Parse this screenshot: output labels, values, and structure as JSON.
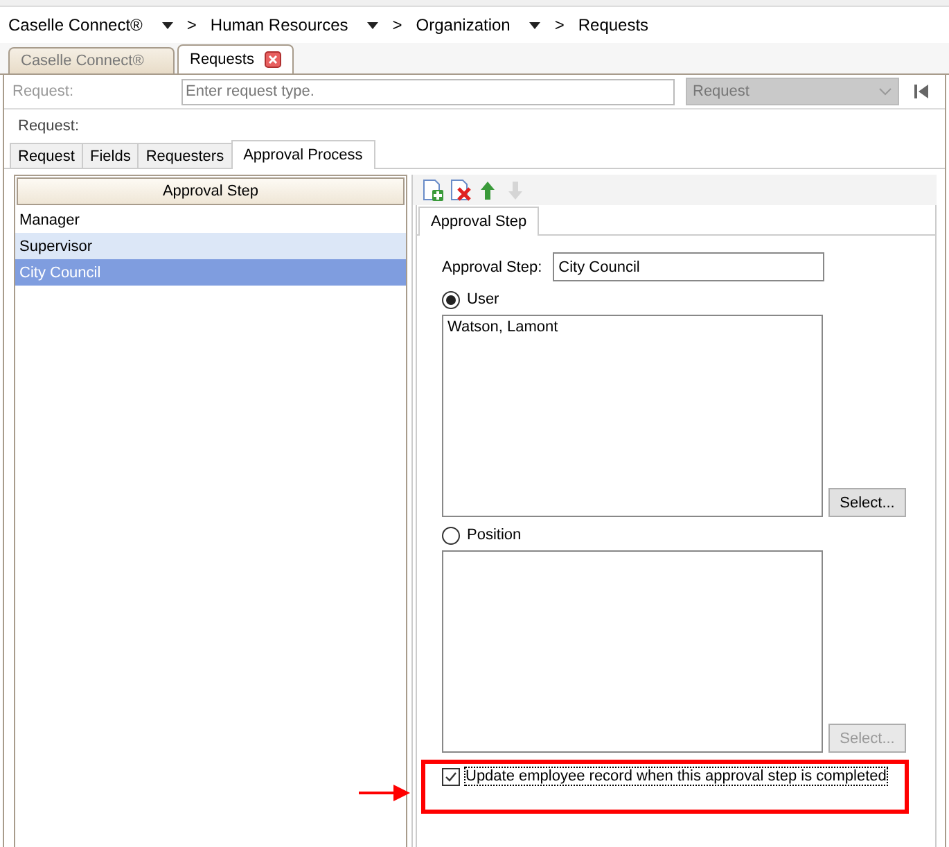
{
  "breadcrumb": [
    {
      "label": "Caselle Connect®",
      "dropdown": true,
      "separator": ">"
    },
    {
      "label": "Human Resources",
      "dropdown": true,
      "separator": ">"
    },
    {
      "label": "Organization",
      "dropdown": true,
      "separator": ">"
    },
    {
      "label": "Requests",
      "dropdown": false
    }
  ],
  "doc_tabs": [
    {
      "label": "Caselle Connect®",
      "selected": false,
      "closable": false
    },
    {
      "label": "Requests",
      "selected": true,
      "closable": true
    }
  ],
  "request_bar": {
    "label": "Request:",
    "placeholder": "Enter request type.",
    "type_select": "Request"
  },
  "request_label": "Request:",
  "tabs": [
    {
      "label": "Request",
      "selected": false
    },
    {
      "label": "Fields",
      "selected": false
    },
    {
      "label": "Requesters",
      "selected": false
    },
    {
      "label": "Approval Process",
      "selected": true
    }
  ],
  "steps_list": {
    "header": "Approval Step",
    "items": [
      {
        "label": "Manager",
        "selected": false,
        "hovered": false
      },
      {
        "label": "Supervisor",
        "selected": false,
        "hovered": true
      },
      {
        "label": "City Council",
        "selected": true,
        "hovered": false
      }
    ]
  },
  "toolbar": [
    {
      "kind": "add",
      "disabled": false
    },
    {
      "kind": "delete",
      "disabled": false
    },
    {
      "kind": "up",
      "disabled": false
    },
    {
      "kind": "down",
      "disabled": true
    }
  ],
  "detail": {
    "tab": "Approval Step",
    "field_label": "Approval Step:",
    "field_value": "City Council",
    "options": [
      {
        "label": "User",
        "selected": true,
        "entries": [
          "Watson, Lamont"
        ],
        "button": "Select...",
        "button_disabled": false
      },
      {
        "label": "Position",
        "selected": false,
        "button": "Select...",
        "button_disabled": true
      }
    ],
    "update_checkbox": {
      "label": "Update employee record when this approval step is completed",
      "checked": true
    }
  }
}
